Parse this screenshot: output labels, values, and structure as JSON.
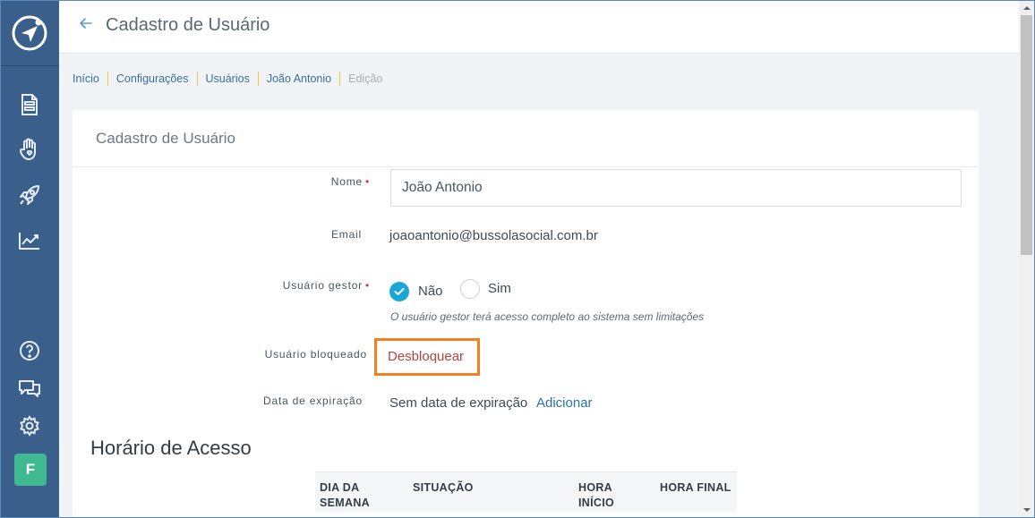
{
  "header": {
    "title": "Cadastro de Usuário"
  },
  "breadcrumb": [
    "Início",
    "Configurações",
    "Usuários",
    "João Antonio",
    "Edição"
  ],
  "card": {
    "title": "Cadastro de Usuário"
  },
  "form": {
    "name_label": "Nome",
    "name_value": "João Antonio",
    "email_label": "Email",
    "email_value": "joaoantonio@bussolasocial.com.br",
    "manager_label": "Usuário gestor",
    "manager_no": "Não",
    "manager_yes": "Sim",
    "manager_selected": "Não",
    "manager_hint": "O usuário gestor terá acesso completo ao sistema sem limitações",
    "blocked_label": "Usuário bloqueado",
    "unlock_link": "Desbloquear",
    "expiration_label": "Data de expiração",
    "expiration_value": "Sem data de expiração",
    "add_link": "Adicionar",
    "required_mark": "•"
  },
  "access": {
    "title": "Horário de Acesso",
    "columns": [
      "DIA DA SEMANA",
      "SITUAÇÃO",
      "HORA INÍCIO",
      "HORA FINAL"
    ]
  },
  "sidebar": {
    "avatar_letter": "F",
    "icons": [
      "document-icon",
      "hand-heart-icon",
      "rocket-icon",
      "chart-icon",
      "help-icon",
      "chat-icon",
      "gear-icon"
    ]
  },
  "colors": {
    "sidebar": "#3a5f8a",
    "accent": "#1aa7d6",
    "highlight": "#f47f20",
    "unlock": "#b2443b",
    "avatar": "#3fb98f"
  }
}
